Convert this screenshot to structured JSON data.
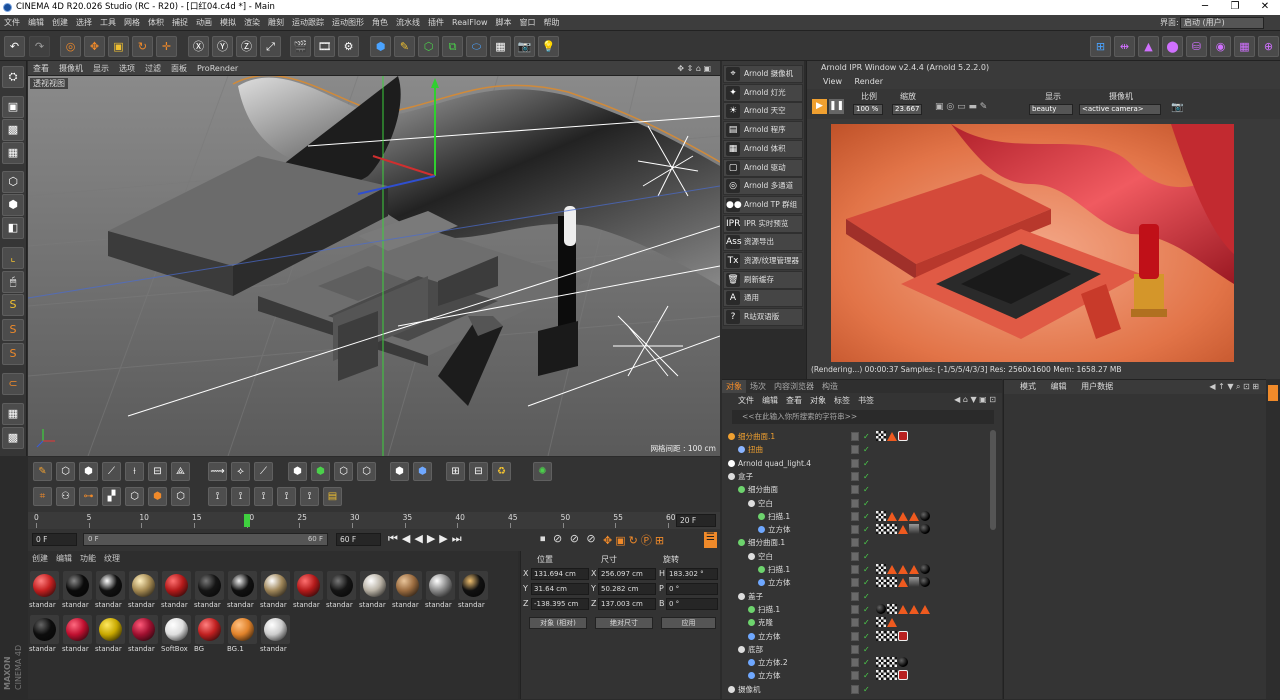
{
  "window": {
    "title": "CINEMA 4D R20.026 Studio (RC - R20) - [口红04.c4d *] - Main"
  },
  "menubar": {
    "items": [
      "文件",
      "编辑",
      "创建",
      "选择",
      "工具",
      "网格",
      "体积",
      "捕捉",
      "动画",
      "模拟",
      "渲染",
      "雕刻",
      "运动跟踪",
      "运动图形",
      "角色",
      "流水线",
      "插件",
      "RealFlow",
      "脚本",
      "窗口",
      "帮助"
    ],
    "layout_label": "界面:",
    "layout_value": "启动 (用户)"
  },
  "viewport": {
    "menu": [
      "查看",
      "摄像机",
      "显示",
      "选项",
      "过滤",
      "面板",
      "ProRender"
    ],
    "label": "透视视图",
    "grid_info": "网格间距 : 100 cm"
  },
  "arnold_menu": {
    "items": [
      {
        "icon": "camera-icon",
        "label": "Arnold 摄像机"
      },
      {
        "icon": "light-icon",
        "label": "Arnold 灯光"
      },
      {
        "icon": "sky-icon",
        "label": "Arnold 天空"
      },
      {
        "icon": "procedural-icon",
        "label": "Arnold 程序"
      },
      {
        "icon": "volume-icon",
        "label": "Arnold 体积"
      },
      {
        "icon": "driver-icon",
        "label": "Arnold 驱动"
      },
      {
        "icon": "aov-icon",
        "label": "Arnold 多通道"
      },
      {
        "icon": "tp-group-icon",
        "label": "Arnold TP 群组"
      },
      {
        "icon": "ipr-icon",
        "label": "IPR 实时预览"
      },
      {
        "icon": "ass-export-icon",
        "label": "资源导出"
      },
      {
        "icon": "texture-manager-icon",
        "label": "资源/纹理管理器"
      },
      {
        "icon": "trash-icon",
        "label": "刷新缓存"
      },
      {
        "icon": "arnold-a-icon",
        "label": "通用"
      },
      {
        "icon": "help-icon",
        "label": "R站双语版"
      }
    ],
    "icon_glyphs": [
      "⌖",
      "✦",
      "☀",
      "▤",
      "▦",
      "▢",
      "◎",
      "●●",
      "IPR",
      "Ass",
      "Tx",
      "🗑",
      "A",
      "?"
    ]
  },
  "ipr": {
    "title": "Arnold IPR Window v2.4.4 (Arnold 5.2.2.0)",
    "menu": [
      "View",
      "Render"
    ],
    "ratio_label": "比例",
    "ratio_value": "100 %",
    "zoom_label": "缩放",
    "zoom_value": "23.667",
    "display_label": "显示",
    "display_value": "beauty",
    "camera_label": "摄像机",
    "camera_value": "<active camera>",
    "status": "(Rendering...) 00:00:37  Samples: [-1/5/5/4/3/3]  Res: 2560x1600  Mem: 1658.27 MB"
  },
  "objects": {
    "tabs": [
      "对象",
      "场次",
      "内容浏览器",
      "构造"
    ],
    "menu": [
      "文件",
      "编辑",
      "查看",
      "对象",
      "标签",
      "书签"
    ],
    "search_placeholder": "<<在此输入你所搜索的字符串>>",
    "rows": [
      {
        "name": "细分曲面.1",
        "indent": 0,
        "color": "#f0a030",
        "selected": true
      },
      {
        "name": "扭曲",
        "indent": 1,
        "color": "#8ab4ff",
        "selected": true
      },
      {
        "name": "Arnold quad_light.4",
        "indent": 0,
        "color": "#ffffff",
        "selected": false
      },
      {
        "name": "盒子",
        "indent": 0,
        "color": "#dddddd",
        "selected": false
      },
      {
        "name": "细分曲面",
        "indent": 1,
        "color": "#6dd36d",
        "selected": false
      },
      {
        "name": "空白",
        "indent": 2,
        "color": "#dddddd",
        "selected": false
      },
      {
        "name": "扫描.1",
        "indent": 3,
        "color": "#6dd36d",
        "selected": false
      },
      {
        "name": "立方体",
        "indent": 3,
        "color": "#6fa8ff",
        "selected": false
      },
      {
        "name": "细分曲面.1",
        "indent": 1,
        "color": "#6dd36d",
        "selected": false
      },
      {
        "name": "空白",
        "indent": 2,
        "color": "#dddddd",
        "selected": false
      },
      {
        "name": "扫描.1",
        "indent": 3,
        "color": "#6dd36d",
        "selected": false
      },
      {
        "name": "立方体",
        "indent": 3,
        "color": "#6fa8ff",
        "selected": false
      },
      {
        "name": "盖子",
        "indent": 1,
        "color": "#dddddd",
        "selected": false
      },
      {
        "name": "扫描.1",
        "indent": 2,
        "color": "#6dd36d",
        "selected": false
      },
      {
        "name": "克隆",
        "indent": 2,
        "color": "#6dd36d",
        "selected": false
      },
      {
        "name": "立方体",
        "indent": 2,
        "color": "#6fa8ff",
        "selected": false
      },
      {
        "name": "底部",
        "indent": 1,
        "color": "#dddddd",
        "selected": false
      },
      {
        "name": "立方体.2",
        "indent": 2,
        "color": "#6fa8ff",
        "selected": false
      },
      {
        "name": "立方体",
        "indent": 2,
        "color": "#6fa8ff",
        "selected": false
      },
      {
        "name": "摄像机",
        "indent": 0,
        "color": "#dddddd",
        "selected": false
      }
    ]
  },
  "attributes": {
    "menu": [
      "模式",
      "编辑",
      "用户数据"
    ]
  },
  "timeline": {
    "ticks": [
      "0",
      "5",
      "10",
      "15",
      "20",
      "25",
      "30",
      "35",
      "40",
      "45",
      "50",
      "55",
      "60"
    ],
    "current": 20,
    "end_label": "20 F",
    "start_field": "0 F",
    "range_start": "0 F",
    "range_end": "60 F",
    "end_field": "60 F"
  },
  "materials": {
    "menu": [
      "创建",
      "编辑",
      "功能",
      "纹理"
    ],
    "items": [
      {
        "label": "standar",
        "color": "#c42020",
        "hl": "#ff8080"
      },
      {
        "label": "standar",
        "color": "#0b0b0b",
        "hl": "#888"
      },
      {
        "label": "standar",
        "color": "#111",
        "hl": "#fff"
      },
      {
        "label": "standar",
        "color": "#a58a52",
        "hl": "#fff0c0"
      },
      {
        "label": "standar",
        "color": "#b31a1a",
        "hl": "#ff7070"
      },
      {
        "label": "standar",
        "color": "#151515",
        "hl": "#777"
      },
      {
        "label": "standar",
        "color": "#111",
        "hl": "#eee"
      },
      {
        "label": "standar",
        "color": "#a0875a",
        "hl": "#fff"
      },
      {
        "label": "standar",
        "color": "#b31a1a",
        "hl": "#ff7070"
      },
      {
        "label": "standar",
        "color": "#151515",
        "hl": "#777"
      },
      {
        "label": "standar",
        "color": "#b9b2a5",
        "hl": "#fff"
      },
      {
        "label": "standar",
        "color": "#9a6b3f",
        "hl": "#e8c49a"
      },
      {
        "label": "standar",
        "color": "#8a8a8a",
        "hl": "#fff"
      },
      {
        "label": "standar",
        "color": "#111",
        "hl": "#f0c070"
      },
      {
        "label": "standar",
        "color": "#0d0d0d",
        "hl": "#666"
      },
      {
        "label": "standar",
        "color": "#c01030",
        "hl": "#ff6a80"
      },
      {
        "label": "standar",
        "color": "#c8a800",
        "hl": "#ffe860"
      },
      {
        "label": "standar",
        "color": "#a01030",
        "hl": "#ff5a7a"
      },
      {
        "label": "SoftBox",
        "color": "#dddddd",
        "hl": "#ffffff"
      },
      {
        "label": "BG",
        "color": "#c02020",
        "hl": "#ff8080"
      },
      {
        "label": "BG.1",
        "color": "#e0822a",
        "hl": "#ffc080"
      },
      {
        "label": "standar",
        "color": "#cccccc",
        "hl": "#ffffff"
      }
    ]
  },
  "coords": {
    "headers": [
      "位置",
      "尺寸",
      "旋转"
    ],
    "rows": [
      {
        "axis": "X",
        "pos": "131.694 cm",
        "size_axis": "X",
        "size": "256.097 cm",
        "rot_axis": "H",
        "rot": "183.302 °"
      },
      {
        "axis": "Y",
        "pos": "31.64 cm",
        "size_axis": "Y",
        "size": "50.282 cm",
        "rot_axis": "P",
        "rot": "0 °"
      },
      {
        "axis": "Z",
        "pos": "-138.395 cm",
        "size_axis": "Z",
        "size": "137.003 cm",
        "rot_axis": "B",
        "rot": "0 °"
      }
    ],
    "mode_dropdown": "对象 (相对)",
    "size_dropdown": "绝对尺寸",
    "apply_button": "应用"
  },
  "brand": {
    "line1": "MAXON",
    "line2": "CINEMA 4D"
  },
  "colors": {
    "accent": "#f08a2a",
    "panel": "#343434",
    "dark": "#262626"
  }
}
